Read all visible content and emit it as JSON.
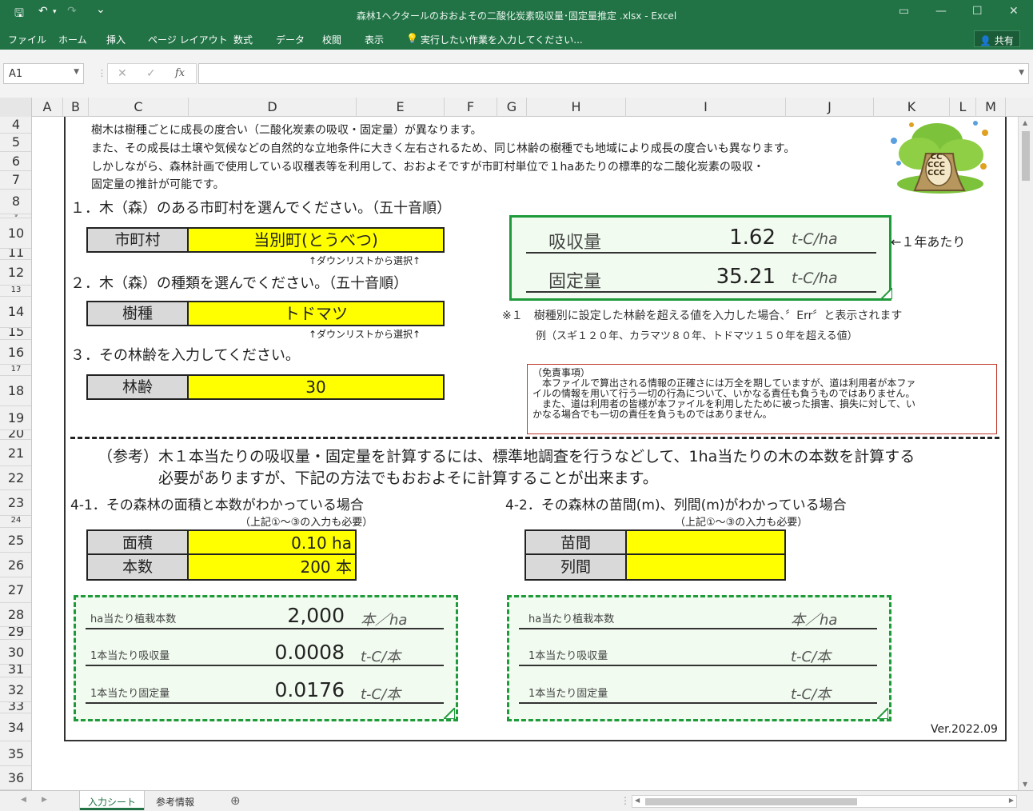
{
  "window": {
    "title": "森林1ヘクタールのおおよその二酸化炭素吸収量･固定量推定 .xlsx - Excel",
    "qa_save": "🖫",
    "qa_undo": "↶",
    "qa_redo": "↷",
    "qa_more": "⌄",
    "ctl_ribbon": "▭",
    "ctl_min": "—",
    "ctl_max": "☐",
    "ctl_close": "✕"
  },
  "ribbon": {
    "tabs": [
      "ファイル",
      "ホーム",
      "挿入",
      "ページ レイアウト",
      "数式",
      "データ",
      "校閲",
      "表示"
    ],
    "tellme": "実行したい作業を入力してください...",
    "share": "共有"
  },
  "formula_bar": {
    "name_box": "A1",
    "cancel": "✕",
    "enter": "✓",
    "fx": "fx",
    "value": ""
  },
  "columns": [
    "A",
    "B",
    "C",
    "D",
    "E",
    "F",
    "G",
    "H",
    "I",
    "J",
    "K",
    "L",
    "M"
  ],
  "rows": [
    "4",
    "5",
    "6",
    "7",
    "8",
    "9",
    "10",
    "11",
    "12",
    "13",
    "14",
    "15",
    "16",
    "17",
    "18",
    "19",
    "20",
    "21",
    "22",
    "23",
    "24",
    "25",
    "26",
    "27",
    "28",
    "29",
    "30",
    "31",
    "32",
    "33",
    "34",
    "35",
    "36"
  ],
  "intro": {
    "line1": "樹木は樹種ごとに成長の度合い（二酸化炭素の吸収・固定量）が異なります。",
    "line2": "また、その成長は土壌や気候などの自然的な立地条件に大きく左右されるため、同じ林齢の樹種でも地域により成長の度合いも異なります。",
    "line3": "しかしながら、森林計画で使用している収穫表等を利用して、おおよそですが市町村単位で１haあたりの標準的な二酸化炭素の吸収・",
    "line4": "固定量の推計が可能です。"
  },
  "step1": {
    "heading": "１．木（森）のある市町村を選んでください。（五十音順）",
    "label": "市町村",
    "value": "当別町(とうべつ)",
    "hint": "↑ダウンリストから選択↑"
  },
  "step2": {
    "heading": "２．木（森）の種類を選んでください。（五十音順）",
    "label": "樹種",
    "value": "トドマツ",
    "hint": "↑ダウンリストから選択↑"
  },
  "step3": {
    "heading": "３．その林齢を入力してください。",
    "label": "林齢",
    "value": "30"
  },
  "result": {
    "absorb_label": "吸収量",
    "absorb_value": "1.62",
    "absorb_unit": "t-C/ha",
    "fixed_label": "固定量",
    "fixed_value": "35.21",
    "fixed_unit": "t-C/ha",
    "per_year": "←１年あたり"
  },
  "notes": {
    "note1": "※１　樹種別に設定した林齢を超える値を入力した場合、〞Err〞と表示されます",
    "note2": "例（スギ１２０年、カラマツ８０年、トドマツ１５０年を超える値）"
  },
  "disclaimer": {
    "l1": "（免責事項）",
    "l2": "　本ファイルで算出される情報の正確さには万全を期していますが、道は利用者が本ファ",
    "l3": "イルの情報を用いて行う一切の行為について、いかなる責任も負うものではありません。",
    "l4": "　また、道は利用者の皆様が本ファイルを利用したために被った損害、損失に対して、い",
    "l5": "かなる場合でも一切の責任を負うものではありません。"
  },
  "reference": {
    "line1": "（参考）木１本当たりの吸収量・固定量を計算するには、標準地調査を行うなどして、1ha当たりの木の本数を計算する",
    "line2": "必要がありますが、下記の方法でもおおよそに計算することが出来ます。"
  },
  "s41": {
    "heading": "4-1．その森林の面積と本数がわかっている場合",
    "sub": "（上記①～③の入力も必要）",
    "area_label": "面積",
    "area_value": "0.10 ha",
    "count_label": "本数",
    "count_value": "200 本",
    "r1_label": "ha当たり植栽本数",
    "r1_value": "2,000",
    "r1_unit": "本／ha",
    "r2_label": "1本当たり吸収量",
    "r2_value": "0.0008",
    "r2_unit": "t-C/本",
    "r3_label": "1本当たり固定量",
    "r3_value": "0.0176",
    "r3_unit": "t-C/本"
  },
  "s42": {
    "heading": "4-2．その森林の苗間(m)、列間(m)がわかっている場合",
    "sub": "（上記①～③の入力も必要）",
    "seed_label": "苗間",
    "seed_value": "",
    "row_label": "列間",
    "row_value": "",
    "r1_label": "ha当たり植栽本数",
    "r1_value": "",
    "r1_unit": "本／ha",
    "r2_label": "1本当たり吸収量",
    "r2_value": "",
    "r2_unit": "t-C/本",
    "r3_label": "1本当たり固定量",
    "r3_value": "",
    "r3_unit": "t-C/本"
  },
  "version": "Ver.2022.09",
  "tree_text": "CC\nCCC\nCCC",
  "sheet_tabs": {
    "active": "入力シート",
    "other": "参考情報",
    "add": "⊕",
    "nav_prev": "◀",
    "nav_next": "▶"
  },
  "colors": {
    "excel_green": "#217346",
    "input_yellow": "#ffff00",
    "box_green": "#1f9a3a",
    "disclaimer_red": "#c0392b"
  }
}
